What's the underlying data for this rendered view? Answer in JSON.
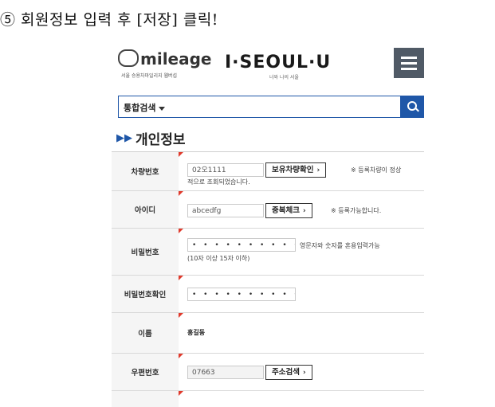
{
  "caption": "⑤ 회원정보 입력 후 [저장] 클릭!",
  "header": {
    "logo_text": "mileage",
    "logo_sub": "서울 승용차마일리지 웹버섭",
    "brand_text": "I·SEOUL·U",
    "brand_sub": "너와 나의 서울"
  },
  "search": {
    "select_label": "통합검색"
  },
  "section": {
    "title": "개인정보",
    "marker": "▶▶"
  },
  "form": {
    "car_number": {
      "label": "차량번호",
      "value": "02오1111",
      "button": "보유차량확인",
      "note_line1": "※ 등록차량이 정상",
      "note_line2": "적으로 조회되었습니다."
    },
    "user_id": {
      "label": "아이디",
      "value": "abcedfg",
      "button": "중복체크",
      "note": "※ 등록가능합니다."
    },
    "password": {
      "label": "비밀번호",
      "value": "• • • • • • • • • • •",
      "note_line1": "영문자와 숫자를 혼용입력가능",
      "note_line2": "(10자 이상 15자 이하)"
    },
    "password_confirm": {
      "label": "비밀번호확인",
      "value": "• • • • • • • • • • •"
    },
    "name": {
      "label": "이름",
      "value": "홍길동"
    },
    "postcode": {
      "label": "우편번호",
      "value": "07663",
      "button": "주소검색"
    }
  },
  "colors": {
    "accent": "#1f57a8",
    "required_mark": "#e03a2c",
    "menu_bg": "#505a66"
  }
}
